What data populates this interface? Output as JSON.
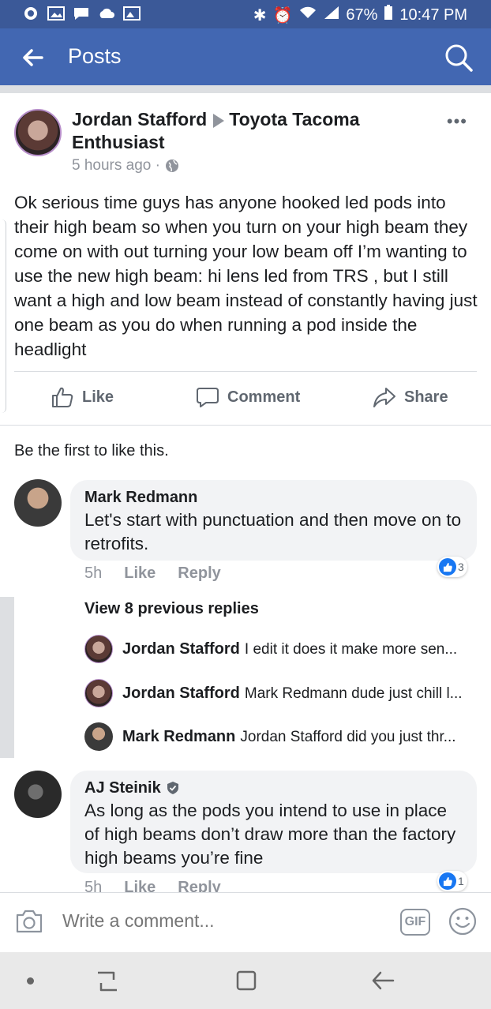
{
  "status_bar": {
    "battery": "67%",
    "time": "10:47 PM"
  },
  "app_bar": {
    "title": "Posts"
  },
  "post": {
    "author": "Jordan Stafford",
    "group": "Toyota Tacoma Enthusiast",
    "time": "5 hours ago ·",
    "text": "Ok serious time guys has anyone hooked led pods into their high beam so when you turn on your high beam they come on with out turning your low beam off I’m wanting to use the new high beam: hi lens led from TRS , but I still want a high and low beam instead of constantly having just one beam as you do when running a pod inside the headlight",
    "actions": {
      "like": "Like",
      "comment": "Comment",
      "share": "Share"
    },
    "likes_summary": "Be the first to like this."
  },
  "comments": [
    {
      "author": "Mark Redmann",
      "text": "Let's start with punctuation and then move on to retrofits.",
      "time": "5h",
      "like": "Like",
      "reply": "Reply",
      "reactions": "3"
    },
    {
      "author": "AJ Steinik",
      "text": "As long as the pods you intend to use in place of high beams don’t draw more than the factory high beams you’re fine",
      "time": "5h",
      "like": "Like",
      "reply": "Reply",
      "reactions": "1"
    }
  ],
  "thread": {
    "view_previous": "View 8 previous replies",
    "replies": [
      {
        "author": "Jordan Stafford",
        "text": "I edit it does it make more sen..."
      },
      {
        "author": "Jordan Stafford",
        "text": "Mark Redmann dude just chill l..."
      },
      {
        "author": "Mark Redmann",
        "text": "Jordan Stafford did you just thr..."
      }
    ]
  },
  "composer": {
    "placeholder": "Write a comment...",
    "gif": "GIF"
  },
  "colors": {
    "brand": "#4267b2",
    "status_bar": "#3b5998",
    "like_blue": "#1877f2"
  }
}
